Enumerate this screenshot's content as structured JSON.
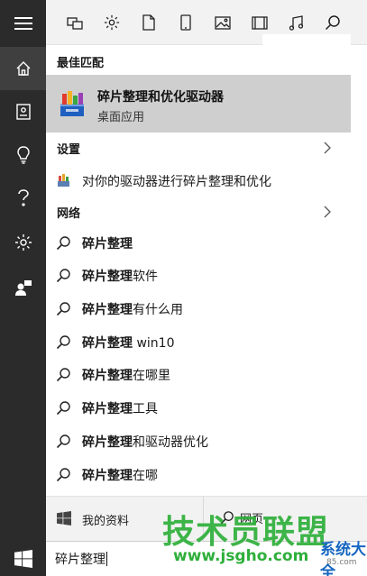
{
  "filters": {
    "icons": [
      "apps-icon",
      "gear-icon",
      "document-icon",
      "tablet-icon",
      "photo-icon",
      "video-icon",
      "music-icon",
      "search-icon"
    ]
  },
  "best_match": {
    "header": "最佳匹配",
    "title": "碎片整理和优化驱动器",
    "subtitle": "桌面应用"
  },
  "settings": {
    "header": "设置",
    "items": [
      {
        "text": "对你的驱动器进行碎片整理和优化"
      }
    ]
  },
  "web": {
    "header": "网络",
    "items": [
      {
        "bold": "碎片整理",
        "rest": ""
      },
      {
        "bold": "碎片整理",
        "rest": "软件"
      },
      {
        "bold": "碎片整理",
        "rest": "有什么用"
      },
      {
        "bold": "碎片整理",
        "rest": " win10"
      },
      {
        "bold": "碎片整理",
        "rest": "在哪里"
      },
      {
        "bold": "碎片整理",
        "rest": "工具"
      },
      {
        "bold": "碎片整理",
        "rest": "和驱动器优化"
      },
      {
        "bold": "碎片整理",
        "rest": "在哪"
      }
    ]
  },
  "scope": {
    "my_stuff": "我的资料",
    "web": "网页"
  },
  "search": {
    "value": "碎片整理"
  },
  "watermark": {
    "main": "技术员联盟",
    "url": "www.jsgho.com",
    "side": "系统大全",
    "side_url": "85.com"
  },
  "colors": {
    "rail": "#2b2b2b",
    "rail_active": "#3f3f3f",
    "highlight": "#cfcfcf",
    "watermark_green": "#2eaf3a",
    "watermark_blue": "#1565c0"
  }
}
